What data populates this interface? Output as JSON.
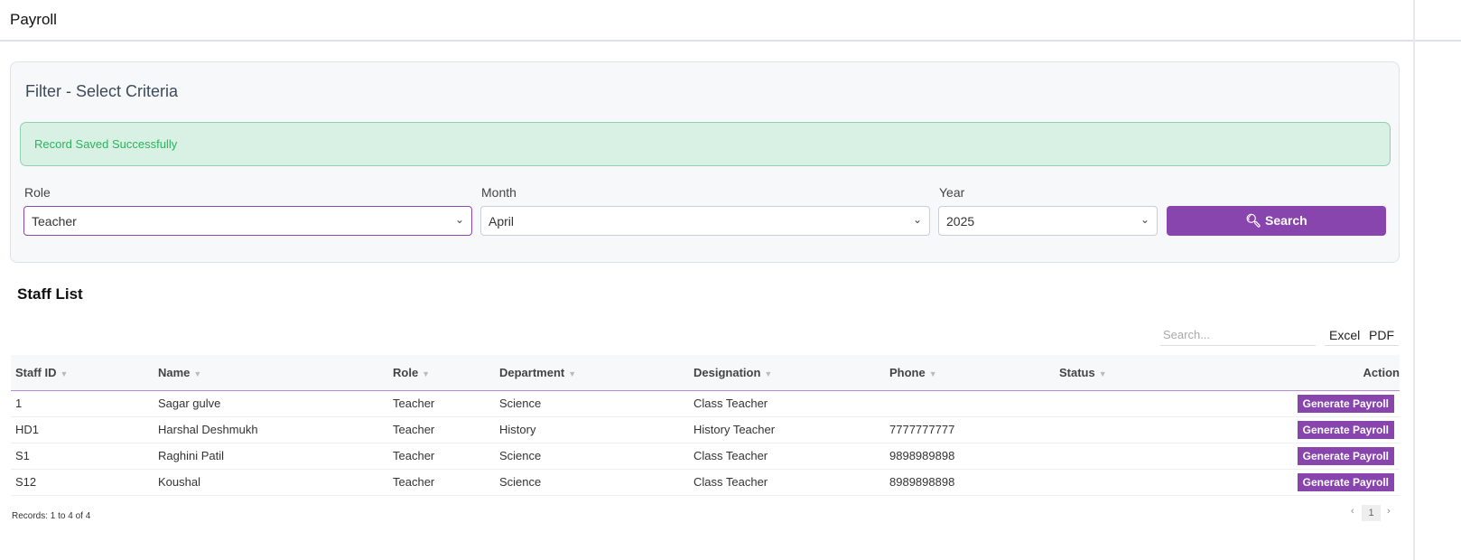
{
  "header": {
    "title": "Payroll"
  },
  "filter": {
    "title": "Filter - Select Criteria",
    "alert": "Record Saved Successfully",
    "role_label": "Role",
    "role_value": "Teacher",
    "month_label": "Month",
    "month_value": "April",
    "year_label": "Year",
    "year_value": "2025",
    "search_button": "Search"
  },
  "staff": {
    "title": "Staff List",
    "search_placeholder": "Search...",
    "excel": "Excel",
    "pdf": "PDF",
    "columns": [
      "Staff ID",
      "Name",
      "Role",
      "Department",
      "Designation",
      "Phone",
      "Status",
      "Action"
    ],
    "rows": [
      {
        "id": "1",
        "name": "Sagar gulve",
        "role": "Teacher",
        "department": "Science",
        "designation": "Class Teacher",
        "phone": "",
        "status": "",
        "action": "Generate Payroll"
      },
      {
        "id": "HD1",
        "name": "Harshal Deshmukh",
        "role": "Teacher",
        "department": "History",
        "designation": "History Teacher",
        "phone": "7777777777",
        "status": "",
        "action": "Generate Payroll"
      },
      {
        "id": "S1",
        "name": "Raghini Patil",
        "role": "Teacher",
        "department": "Science",
        "designation": "Class Teacher",
        "phone": "9898989898",
        "status": "",
        "action": "Generate Payroll"
      },
      {
        "id": "S12",
        "name": "Koushal",
        "role": "Teacher",
        "department": "Science",
        "designation": "Class Teacher",
        "phone": "8989898898",
        "status": "",
        "action": "Generate Payroll"
      }
    ],
    "records": "Records: 1 to 4 of 4",
    "page": "1"
  },
  "colors": {
    "accent": "#8745ad",
    "alert_bg": "#d9f0e4",
    "alert_text": "#2bb45c"
  }
}
